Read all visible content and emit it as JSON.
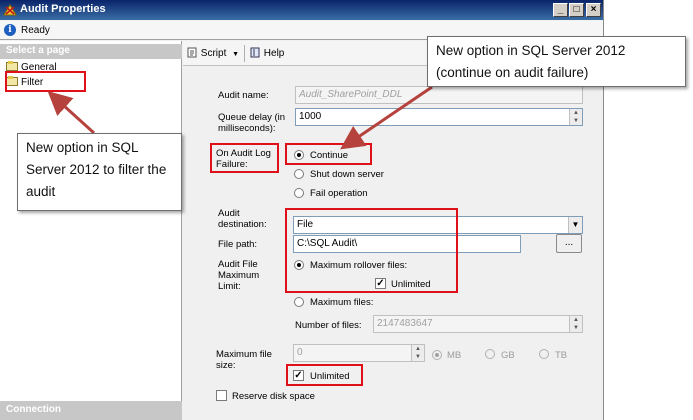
{
  "window": {
    "title": "Audit Properties",
    "status": "Ready"
  },
  "left_pane": {
    "select_header": "Select a page",
    "pages": [
      {
        "label": "General"
      },
      {
        "label": "Filter"
      }
    ],
    "connection_header": "Connection"
  },
  "toolbar": {
    "script_label": "Script",
    "help_label": "Help"
  },
  "form": {
    "audit_name_label": "Audit name:",
    "audit_name_value": "Audit_SharePoint_DDL",
    "queue_delay_label": "Queue delay (in milliseconds):",
    "queue_delay_value": "1000",
    "failure_label": "On Audit Log Failure:",
    "failure_options": [
      "Continue",
      "Shut down server",
      "Fail operation"
    ],
    "failure_selected": "Continue",
    "destination_label": "Audit destination:",
    "destination_value": "File",
    "file_path_label": "File path:",
    "file_path_value": "C:\\SQL Audit\\",
    "browse_label": "...",
    "max_limit_label": "Audit File Maximum Limit:",
    "max_rollover_label": "Maximum rollover files:",
    "unlimited_label": "Unlimited",
    "max_files_label": "Maximum files:",
    "number_of_files_label": "Number of files:",
    "number_of_files_value": "2147483647",
    "max_file_size_label": "Maximum file size:",
    "max_file_size_value": "0",
    "units": [
      "MB",
      "GB",
      "TB"
    ],
    "unlimited_size_label": "Unlimited",
    "reserve_disk_label": "Reserve disk space"
  },
  "callouts": {
    "filter_note": "New option in SQL Server 2012 to filter the audit",
    "continue_note": "New option in SQL Server 2012 (continue on audit failure)"
  },
  "colors": {
    "annotation_red": "#e0101a",
    "titlebar_blue": "#0a246a"
  }
}
